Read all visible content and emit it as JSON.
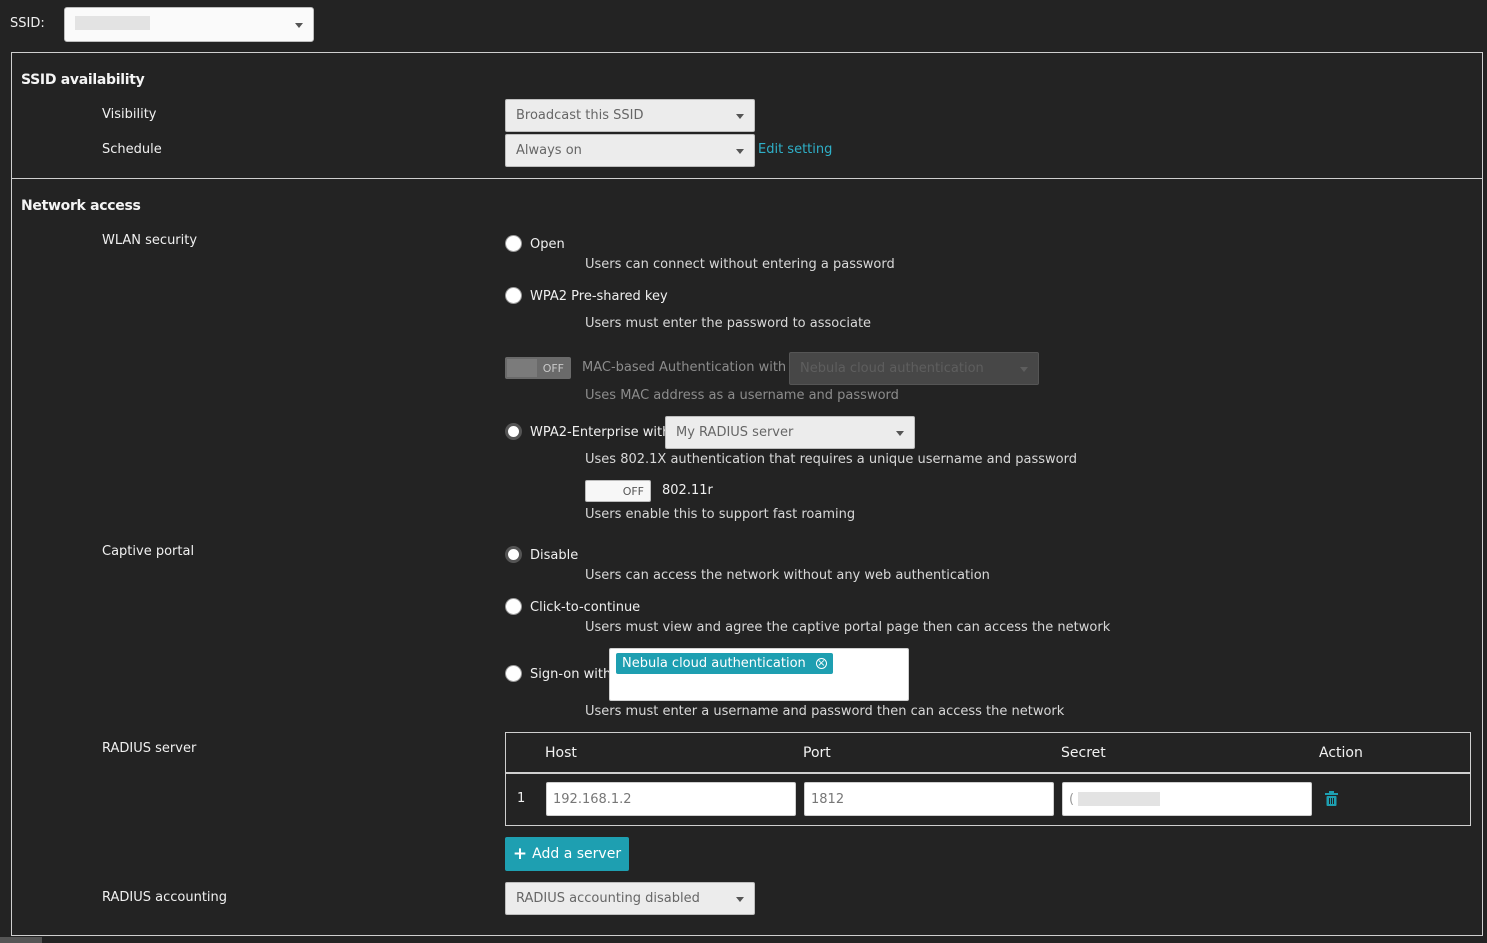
{
  "ssid": {
    "label": "SSID:",
    "value": ""
  },
  "availability": {
    "title": "SSID availability",
    "visibility_label": "Visibility",
    "visibility_value": "Broadcast this SSID",
    "schedule_label": "Schedule",
    "schedule_value": "Always on",
    "edit_setting": "Edit setting"
  },
  "network": {
    "title": "Network access",
    "wlan_label": "WLAN security",
    "open_label": "Open",
    "open_desc": "Users can connect without entering a password",
    "wpa2psk_label": "WPA2 Pre-shared key",
    "wpa2psk_desc": "Users must enter the password to associate",
    "mac_toggle": "OFF",
    "mac_label": "MAC-based Authentication with",
    "mac_select": "Nebula cloud authentication",
    "mac_desc": "Uses MAC address as a username and password",
    "wpa2ent_label": "WPA2-Enterprise with",
    "wpa2ent_select": "My RADIUS server",
    "wpa2ent_desc": "Uses 802.1X authentication that requires a unique username and password",
    "r_toggle": "OFF",
    "r_label": "802.11r",
    "r_desc": "Users enable this to support fast roaming",
    "captive_label": "Captive portal",
    "disable_label": "Disable",
    "disable_desc": "Users can access the network without any web authentication",
    "click_label": "Click-to-continue",
    "click_desc": "Users must view and agree the captive portal page then can access the network",
    "signon_label": "Sign-on with",
    "signon_tag": "Nebula cloud authentication",
    "signon_desc": "Users must enter a username and password then can access the network",
    "radius_label": "RADIUS server",
    "radius_table": {
      "headers": [
        "Host",
        "Port",
        "Secret",
        "Action"
      ],
      "rows": [
        {
          "index": "1",
          "host": "192.168.1.2",
          "port": "1812",
          "secret": "("
        }
      ]
    },
    "add_server": "Add a server",
    "accounting_label": "RADIUS accounting",
    "accounting_value": "RADIUS accounting disabled"
  },
  "icons": {
    "trash": "trash-icon",
    "plus": "plus-icon",
    "caret": "caret-down-icon",
    "remove": "remove-tag-icon"
  },
  "colors": {
    "accent": "#1e9fb1",
    "link": "#2fb0c8",
    "background": "#232323"
  }
}
